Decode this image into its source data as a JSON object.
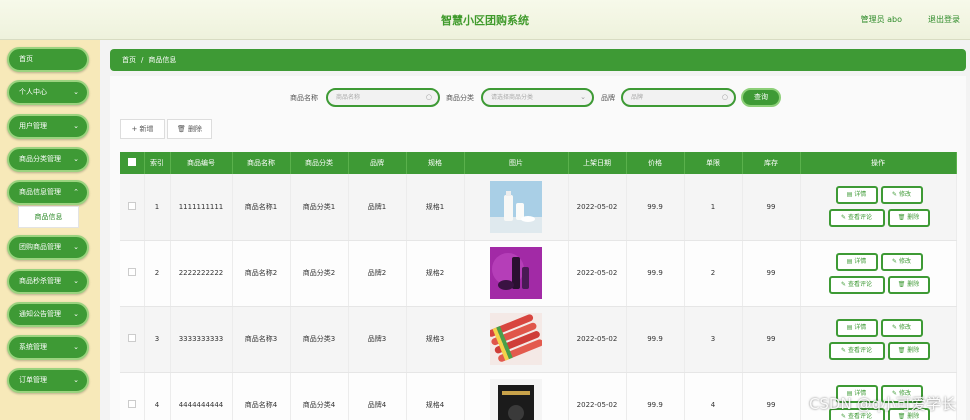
{
  "header": {
    "title": "智慧小区团购系统",
    "user": "管理员 abo",
    "logout": "退出登录"
  },
  "sidebar": {
    "items": [
      {
        "label": "首页",
        "chevron": ""
      },
      {
        "label": "个人中心",
        "chevron": "⌄"
      },
      {
        "label": "用户管理",
        "chevron": "⌄"
      },
      {
        "label": "商品分类管理",
        "chevron": "⌄"
      },
      {
        "label": "商品信息管理",
        "chevron": "⌃"
      },
      {
        "label": "团购商品管理",
        "chevron": "⌄"
      },
      {
        "label": "商品秒杀管理",
        "chevron": "⌄"
      },
      {
        "label": "通知公告管理",
        "chevron": "⌄"
      },
      {
        "label": "系统管理",
        "chevron": "⌄"
      },
      {
        "label": "订单管理",
        "chevron": "⌄"
      }
    ],
    "submenu_active": "商品信息"
  },
  "breadcrumb": {
    "home": "首页",
    "sep": "/",
    "current": "商品信息"
  },
  "search": {
    "name_label": "商品名称",
    "name_placeholder": "商品名称",
    "category_label": "商品分类",
    "category_placeholder": "请选择商品分类",
    "brand_label": "品牌",
    "brand_placeholder": "品牌",
    "query": "查询"
  },
  "toolbar": {
    "add": "+ 新增",
    "delete": "🗑 删除"
  },
  "table": {
    "columns": [
      "",
      "索引",
      "商品编号",
      "商品名称",
      "商品分类",
      "品牌",
      "规格",
      "图片",
      "上架日期",
      "价格",
      "单限",
      "库存",
      "操作"
    ],
    "rows": [
      {
        "idx": "1",
        "code": "1111111111",
        "name": "商品名称1",
        "cat": "商品分类1",
        "brand": "品牌1",
        "spec": "规格1",
        "img": "milk",
        "date": "2022-05-02",
        "price": "99.9",
        "limit": "1",
        "stock": "99"
      },
      {
        "idx": "2",
        "code": "2222222222",
        "name": "商品名称2",
        "cat": "商品分类2",
        "brand": "品牌2",
        "spec": "规格2",
        "img": "cosmetics",
        "date": "2022-05-02",
        "price": "99.9",
        "limit": "2",
        "stock": "99"
      },
      {
        "idx": "3",
        "code": "3333333333",
        "name": "商品名称3",
        "cat": "商品分类3",
        "brand": "品牌3",
        "spec": "规格3",
        "img": "sausages",
        "date": "2022-05-02",
        "price": "99.9",
        "limit": "3",
        "stock": "99"
      },
      {
        "idx": "4",
        "code": "4444444444",
        "name": "商品名称4",
        "cat": "商品分类4",
        "brand": "品牌4",
        "spec": "规格4",
        "img": "box",
        "date": "2022-05-02",
        "price": "99.9",
        "limit": "4",
        "stock": "99"
      }
    ],
    "ops": {
      "detail": "▤ 详情",
      "edit": "✎ 修改",
      "review": "✎ 查看评论",
      "delete": "🗑 删除"
    }
  },
  "watermark": "CSDN @q小可爱学长",
  "colors": {
    "primary": "#3e9a35",
    "sidebar_bg": "#f7e9b9",
    "header_bg": "#f3f6e3"
  }
}
